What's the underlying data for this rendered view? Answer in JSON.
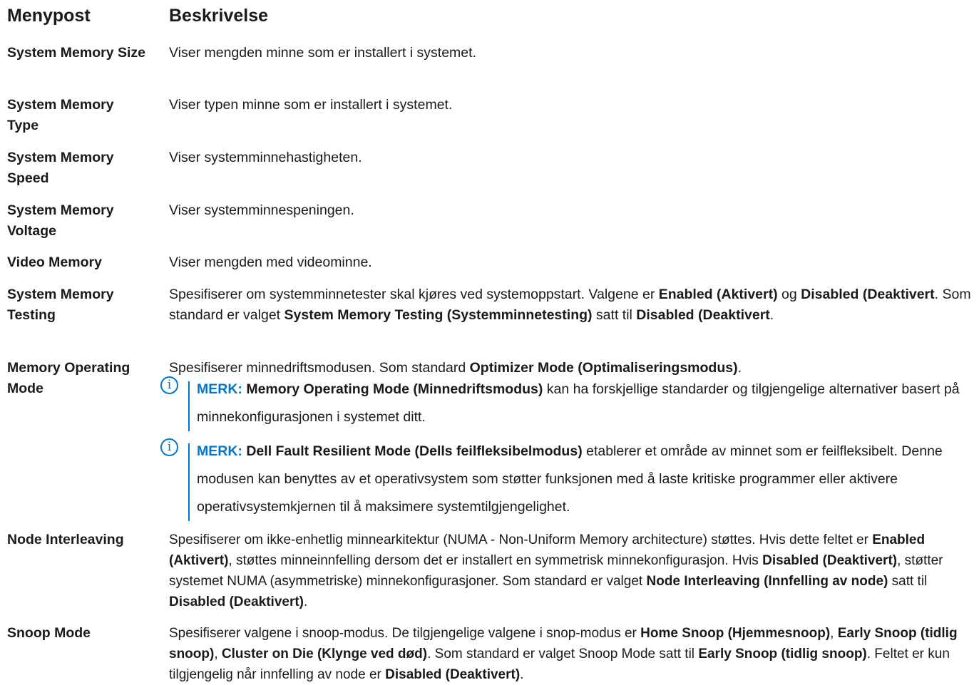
{
  "headers": {
    "col1": "Menypost",
    "col2": "Beskrivelse"
  },
  "rows": [
    {
      "item": "System Memory Size",
      "desc": "Viser mengden minne som er installert i systemet."
    },
    {
      "item": "System Memory Type",
      "desc": "Viser typen minne som er installert i systemet."
    },
    {
      "item": "System Memory Speed",
      "desc": "Viser systemminnehastigheten."
    },
    {
      "item": "System Memory Voltage",
      "desc": "Viser systemminnespeningen."
    },
    {
      "item": "Video Memory",
      "desc": "Viser mengden med videominne."
    },
    {
      "item": "System Memory Testing",
      "desc": [
        "Spesifiserer om systemminnetester skal kjøres ved systemoppstart. Valgene er ",
        "Enabled (Aktivert)",
        " og ",
        "Disabled (Deaktivert",
        ". Som standard er valget ",
        "System Memory Testing (Systemminnetesting)",
        " satt til ",
        "Disabled (Deaktivert",
        "."
      ]
    },
    {
      "item": "Memory Operating Mode",
      "desc": [
        "Spesifiserer minnedriftsmodusen. Som standard ",
        "Optimizer Mode (Optimaliseringsmodus)",
        "."
      ],
      "notes": [
        {
          "label": "MERK:",
          "bold": "Memory Operating Mode (Minnedriftsmodus)",
          "text": " kan ha forskjellige standarder og tilgjengelige alternativer basert på minnekonfigurasjonen i systemet ditt."
        },
        {
          "label": "MERK:",
          "bold": "Dell Fault Resilient Mode (Dells feilfleksibelmodus)",
          "text": " etablerer et område av minnet som er feilfleksibelt. Denne modusen kan benyttes av et operativsystem som støtter funksjonen med å laste kritiske programmer eller aktivere operativsystemkjernen til å maksimere systemtilgjengelighet."
        }
      ]
    },
    {
      "item": "Node Interleaving",
      "desc": [
        "Spesifiserer om ikke-enhetlig minnearkitektur (NUMA - Non-Uniform Memory architecture) støttes. Hvis dette feltet er ",
        "Enabled (Aktivert)",
        ", støttes minneinnfelling dersom det er installert en symmetrisk minnekonfigurasjon. Hvis ",
        "Disabled (Deaktivert)",
        ", støtter systemet NUMA (asymmetriske) minnekonfigurasjoner. Som standard er valget ",
        "Node Interleaving (Innfelling av node)",
        " satt til ",
        "Disabled (Deaktivert)",
        "."
      ]
    },
    {
      "item": "Snoop Mode",
      "desc": [
        "Spesifiserer valgene i snoop-modus. De tilgjengelige valgene i snop-modus er ",
        "Home Snoop (Hjemmesnoop)",
        ", ",
        "Early Snoop (tidlig snoop)",
        ", ",
        "Cluster on Die (Klynge ved død)",
        ". Som standard er valget Snoop Mode satt til ",
        "Early Snoop (tidlig snoop)",
        ". Feltet er kun tilgjengelig når innfelling av node er ",
        "Disabled (Deaktivert)",
        "."
      ]
    }
  ],
  "icon": "info-icon",
  "accent_color": "#0076ce"
}
